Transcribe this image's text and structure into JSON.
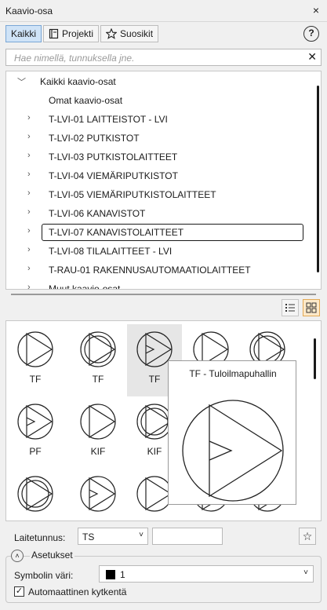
{
  "window": {
    "title": "Kaavio-osa",
    "close_glyph": "×"
  },
  "tabs": [
    {
      "label": "Kaikki",
      "active": true
    },
    {
      "label": "Projekti",
      "icon": "book-icon"
    },
    {
      "label": "Suosikit",
      "icon": "star-icon"
    }
  ],
  "help_glyph": "?",
  "search": {
    "placeholder": "Hae nimellä, tunnuksella jne.",
    "clear_glyph": "✕"
  },
  "tree": {
    "items": [
      {
        "label": "Kaikki kaavio-osat",
        "chevron": "﹀",
        "level": 0
      },
      {
        "label": "Omat kaavio-osat",
        "chevron": "",
        "level": 1
      },
      {
        "label": "T-LVI-01  LAITTEISTOT - LVI",
        "chevron": "›",
        "level": 1
      },
      {
        "label": "T-LVI-02  PUTKISTOT",
        "chevron": "›",
        "level": 1
      },
      {
        "label": "T-LVI-03  PUTKISTOLAITTEET",
        "chevron": "›",
        "level": 1
      },
      {
        "label": "T-LVI-04  VIEMÄRIPUTKISTOT",
        "chevron": "›",
        "level": 1
      },
      {
        "label": "T-LVI-05  VIEMÄRIPUTKISTOLAITTEET",
        "chevron": "›",
        "level": 1
      },
      {
        "label": "T-LVI-06  KANAVISTOT",
        "chevron": "›",
        "level": 1
      },
      {
        "label": "T-LVI-07  KANAVISTOLAITTEET",
        "chevron": "›",
        "level": 1,
        "selected": true
      },
      {
        "label": "T-LVI-08  TILALAITTEET - LVI",
        "chevron": "›",
        "level": 1
      },
      {
        "label": "T-RAU-01  RAKENNUSAUTOMAATIOLAITTEET",
        "chevron": "›",
        "level": 1
      },
      {
        "label": "Muut kaavio-osat",
        "chevron": "›",
        "level": 1
      }
    ]
  },
  "symbols": {
    "items": [
      {
        "name": "TF",
        "variant": "plain"
      },
      {
        "name": "TF",
        "variant": "double"
      },
      {
        "name": "TF",
        "variant": "inner-tri",
        "hover": true
      },
      {
        "name": "TF",
        "variant": "plain"
      },
      {
        "name": "TF",
        "variant": "double"
      },
      {
        "name": "PF",
        "variant": "inner-tri"
      },
      {
        "name": "KIF",
        "variant": "plain"
      },
      {
        "name": "KIF",
        "variant": "double"
      },
      {
        "name": "",
        "variant": "plain"
      },
      {
        "name": "",
        "variant": "plain"
      },
      {
        "name": "",
        "variant": "double"
      },
      {
        "name": "",
        "variant": "inner-tri"
      },
      {
        "name": "",
        "variant": "plain"
      },
      {
        "name": "",
        "variant": "plain"
      },
      {
        "name": "",
        "variant": "plain"
      }
    ],
    "tooltip_title": "TF - Tuloilmapuhallin"
  },
  "laitetunnus": {
    "label": "Laitetunnus:",
    "value": "TS",
    "arrow": "˅",
    "extra_value": "",
    "star_glyph": "☆"
  },
  "asetukset": {
    "title": "Asetukset",
    "toggle_glyph": "˄",
    "symbol_color": {
      "label": "Symbolin väri:",
      "value": "1",
      "swatch": "#000000",
      "arrow": "˅"
    },
    "auto_connect": {
      "label": "Automaattinen kytkentä",
      "checked": true,
      "check_glyph": "✓"
    }
  },
  "colors": {
    "accent": "#7aa7d6",
    "selection": "#1a1a1a",
    "view_active": "#fde9c9"
  }
}
